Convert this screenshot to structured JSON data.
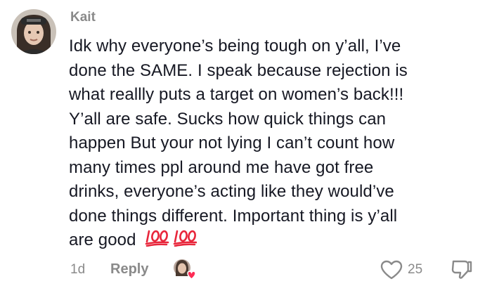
{
  "comment": {
    "username": "Kait",
    "lines": [
      "Idk why everyone’s being tough on y’all, I’ve",
      "done the SAME. I speak because rejection is",
      "what reallly puts a target on women’s back!!!",
      "Y’all are safe. Sucks how quick things can",
      "happen But your not lying I can’t count how",
      "many times ppl around me have got free",
      "drinks, everyone’s acting like they would’ve",
      "done things different. Important thing is y’all",
      "are good"
    ],
    "emoji": "💯 💯",
    "emoji_color": "#e8263b",
    "avatar_icon": "user-avatar"
  },
  "footer": {
    "date": "1d",
    "reply_label": "Reply",
    "creator_liked_icon": "creator-liked-heart",
    "like_count": "25",
    "like_icon": "heart-outline-icon",
    "dislike_icon": "thumbs-down-outline-icon"
  },
  "colors": {
    "text": "#161823",
    "muted": "#8a8a8a",
    "heart_red": "#fe2c55"
  }
}
